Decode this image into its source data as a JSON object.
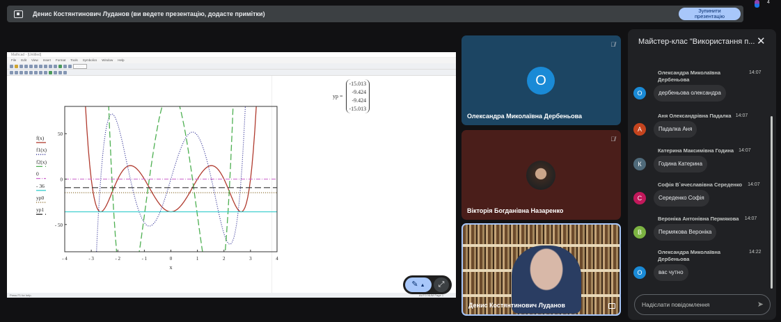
{
  "topbar": {
    "title": "Денис Костянтинович Луданов (ви ведете презентацію, додасте примітки)",
    "stop_line1": "Зупинити",
    "stop_line2": "презентацію",
    "participant_count": "4"
  },
  "mathcad": {
    "window_title": "Mathcad - [Untitled]",
    "menu": [
      "File",
      "Edit",
      "View",
      "Insert",
      "Format",
      "Tools",
      "Symbolics",
      "Window",
      "Help"
    ],
    "zoom": "200%",
    "status_left": "Press F1 for help.",
    "status_right": "AUTO   NUM  Page 1",
    "yp_label": "yp =",
    "yp_values": [
      "-15.013",
      "-9.424",
      "-9.424",
      "-15.013"
    ]
  },
  "chart_data": {
    "type": "line",
    "xlabel": "x",
    "ylabel": "",
    "xlim": [
      -4,
      4
    ],
    "ylim": [
      -80,
      80
    ],
    "x_ticks": [
      "- 4",
      "- 3",
      "- 2",
      "- 1",
      "0",
      "1",
      "2",
      "3",
      "4"
    ],
    "y_ticks": [
      "50",
      "0",
      "- 50"
    ],
    "legend": [
      "f(x)",
      "f1(x)",
      "f2(x)",
      "0",
      "- 36",
      "yp0",
      "yp1"
    ],
    "series": [
      {
        "name": "f(x)",
        "formula": "x^2(x^2-7)^2-36",
        "color": "#b03a2e",
        "style": "solid"
      },
      {
        "name": "f1(x)",
        "formula": "2x(x^2-7)(3x^2-7)",
        "color": "#3a3a9a",
        "style": "dotted"
      },
      {
        "name": "f2(x)",
        "formula": "30x^4-168x^2+98",
        "color": "#4caf50",
        "style": "dashed"
      },
      {
        "name": "0",
        "value": 0,
        "color": "#cc66cc",
        "style": "dashdot"
      },
      {
        "name": "- 36",
        "value": -36,
        "color": "#33cccc",
        "style": "solid"
      },
      {
        "name": "yp0",
        "value": -15.013,
        "color": "#8a6a2a",
        "style": "dotted"
      },
      {
        "name": "yp1",
        "value": -9.424,
        "color": "#333333",
        "style": "dashed"
      }
    ]
  },
  "tiles": [
    {
      "name": "Олександра Миколаївна Дербеньова",
      "initial": "О"
    },
    {
      "name": "Вікторія Богданівна Назаренко"
    },
    {
      "name": "Денис Костянтинович Луданов"
    }
  ],
  "chat": {
    "title": "Майстер-клас \"Використання п...",
    "input_placeholder": "Надіслати повідомлення",
    "messages": [
      {
        "sender": "Олександра Миколаївна Дербеньова",
        "initial": "О",
        "color": "#1a8ad6",
        "time": "14:07",
        "text": "дербеньова олександра"
      },
      {
        "sender": "Аня Олександрівна Падалка",
        "initial": "А",
        "color": "#c5441e",
        "time": "14:07",
        "text": "Падалка Аня"
      },
      {
        "sender": "Катерина Максимівна Година",
        "initial": "К",
        "color": "#4f6a7a",
        "time": "14:07",
        "text": "Година Катерина"
      },
      {
        "sender": "Софія В`ячеславівна Середенко",
        "initial": "С",
        "color": "#c2185b",
        "time": "14:07",
        "text": "Середенко Софія"
      },
      {
        "sender": "Вероніка Антонівна Пермякова",
        "initial": "В",
        "color": "#7cb342",
        "time": "14:07",
        "text": "Пермякова Вероніка"
      },
      {
        "sender": "Олександра Миколаївна Дербеньова",
        "initial": "О",
        "color": "#1a8ad6",
        "time": "14:22",
        "text": "вас чутно"
      }
    ]
  }
}
